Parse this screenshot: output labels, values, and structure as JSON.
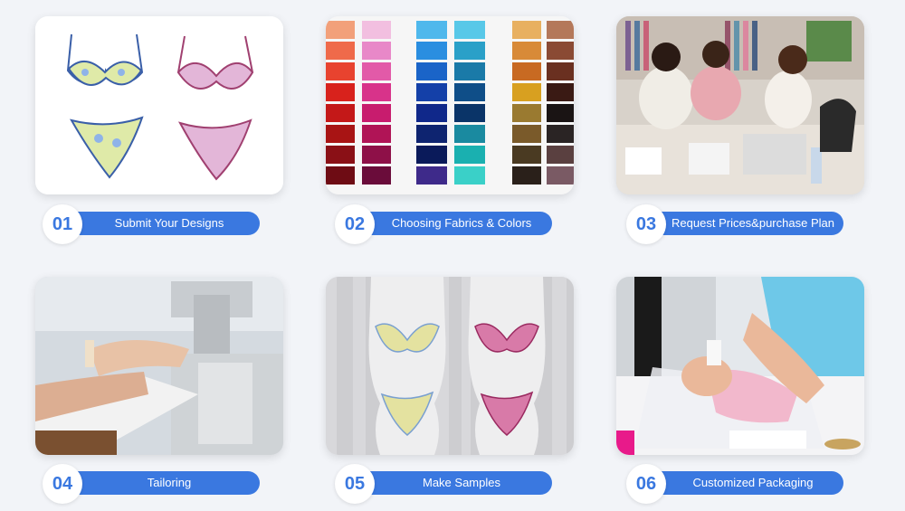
{
  "steps": [
    {
      "number": "01",
      "label": "Submit Your Designs"
    },
    {
      "number": "02",
      "label": "Choosing Fabrics & Colors"
    },
    {
      "number": "03",
      "label": "Request Prices&purchase Plan"
    },
    {
      "number": "04",
      "label": "Tailoring"
    },
    {
      "number": "05",
      "label": "Make Samples"
    },
    {
      "number": "06",
      "label": "Customized Packaging"
    }
  ],
  "colors": {
    "accent": "#3a78e0",
    "background": "#f2f4f8"
  }
}
